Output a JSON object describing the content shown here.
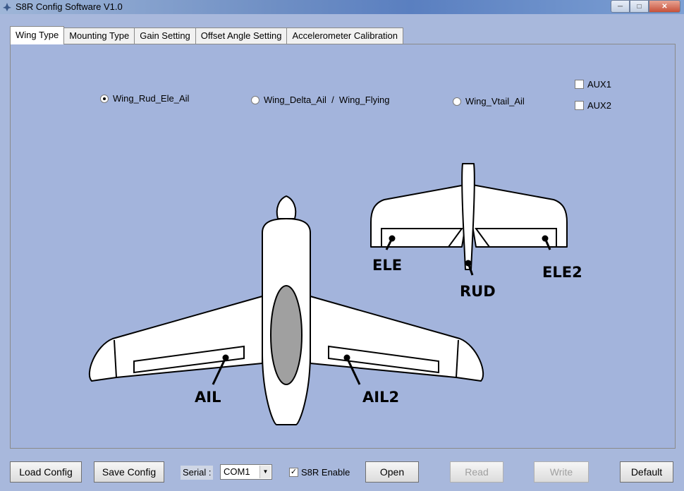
{
  "window": {
    "title": "S8R Config Software V1.0"
  },
  "tabs": [
    {
      "label": "Wing Type",
      "active": true
    },
    {
      "label": "Mounting Type"
    },
    {
      "label": "Gain Setting"
    },
    {
      "label": "Offset Angle Setting"
    },
    {
      "label": "Accelerometer Calibration"
    }
  ],
  "wing_type": {
    "options": [
      {
        "label": "Wing_Rud_Ele_Ail",
        "selected": true
      },
      {
        "label": "Wing_Delta_Ail  /  Wing_Flying",
        "selected": false
      },
      {
        "label": "Wing_Vtail_Ail",
        "selected": false
      }
    ],
    "aux": [
      {
        "label": "AUX1",
        "checked": false
      },
      {
        "label": "AUX2",
        "checked": false
      }
    ]
  },
  "diagram": {
    "labels": {
      "ail": "AIL",
      "ail2": "AIL2",
      "ele": "ELE",
      "ele2": "ELE2",
      "rud": "RUD"
    }
  },
  "bottom": {
    "load_config": "Load Config",
    "save_config": "Save Config",
    "serial_label": "Serial :",
    "serial_port": "COM1",
    "s8r_enable": "S8R Enable",
    "s8r_enable_checked": true,
    "open": "Open",
    "read": "Read",
    "write": "Write",
    "default": "Default"
  },
  "colors": {
    "panel": "#a3b4dc",
    "fuselage_window": "#a0a0a0"
  }
}
